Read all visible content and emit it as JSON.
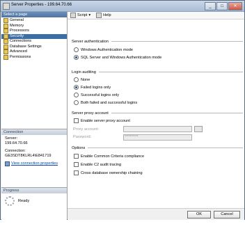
{
  "window": {
    "title": "Server Properties - 199.64.70.66"
  },
  "left_panel": {
    "header": "Select a page",
    "pages": [
      "General",
      "Memory",
      "Processors",
      "Security",
      "Connections",
      "Database Settings",
      "Advanced",
      "Permissions"
    ],
    "selected_index": 3
  },
  "connection": {
    "header": "Connection",
    "server_label": "Server:",
    "server_value": "199.64.70.66",
    "connection_label": "Connection:",
    "connection_value": "GE3SDT8KLRL4\\E841719",
    "link": "View connection properties"
  },
  "progress": {
    "header": "Progress",
    "status": "Ready"
  },
  "toolbar": {
    "script": "Script",
    "help": "Help"
  },
  "server_auth": {
    "title": "Server authentication",
    "options": [
      "Windows Authentication mode",
      "SQL Server and Windows Authentication mode"
    ],
    "selected": 1
  },
  "login_auditing": {
    "title": "Login auditing",
    "options": [
      "None",
      "Failed logins only",
      "Successful logins only",
      "Both failed and successful logins"
    ],
    "selected": 1
  },
  "proxy": {
    "title": "Server proxy account",
    "enable_label": "Enable server proxy account",
    "enabled": false,
    "account_label": "Proxy account:",
    "account_value": "",
    "password_label": "Password:",
    "password_value": "**********"
  },
  "options": {
    "title": "Options",
    "items": [
      "Enable Common Criteria compliance",
      "Enable C2 audit tracing",
      "Cross database ownership chaining"
    ]
  },
  "buttons": {
    "ok": "OK",
    "cancel": "Cancel"
  }
}
